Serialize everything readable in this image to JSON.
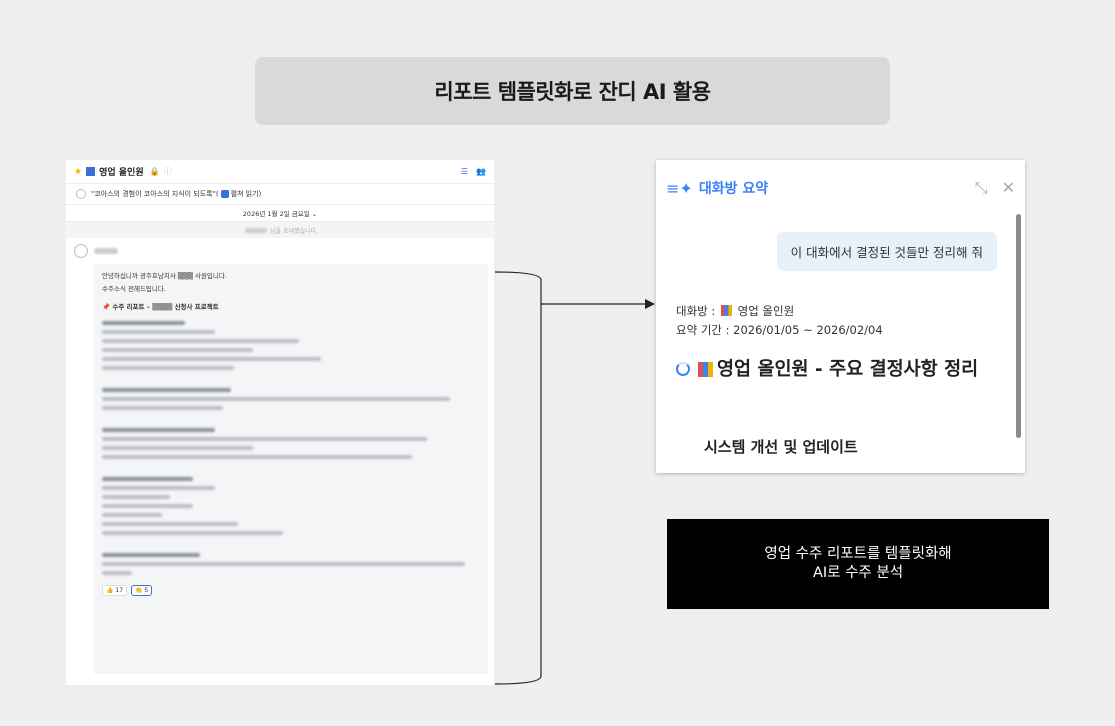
{
  "title": "리포트 템플릿화로 잔디 AI 활용",
  "chat": {
    "room_name": "영업 올인원",
    "notice": "\"코아스의 경험이 코아스의 지식이 되도록\"(",
    "notice_link": "펼쳐 읽기)",
    "date": "2026년 1월 2일 금요일 ⌄",
    "invite_suffix": "님을 초대했습니다.",
    "greeting": "안녕하십니까 광주호남지사",
    "greeting_end": "사원입니다.",
    "line2": "수주소식 전해드립니다.",
    "report_prefix": "수주 리포트 –",
    "report_suffix": "신청사 프로젝트",
    "reactions": [
      "👍 17",
      "👏 5"
    ]
  },
  "panel": {
    "title": "대화방 요약",
    "user_message": "이 대화에서 결정된 것들만 정리해 줘",
    "room_label": "대화방 :",
    "room_name": "영업 올인원",
    "period": "요약 기간 : 2026/01/05 ~ 2026/02/04",
    "heading": "영업 올인원 - 주요 결정사항 정리",
    "subheading": "시스템 개선 및 업데이트"
  },
  "caption": {
    "line1": "영업 수주 리포트를 템플릿화해",
    "line2": "AI로 수주 분석"
  },
  "colors": {
    "accent": "#3b82f6",
    "caption_bg": "#000000",
    "title_bg": "#d9d9d9"
  }
}
